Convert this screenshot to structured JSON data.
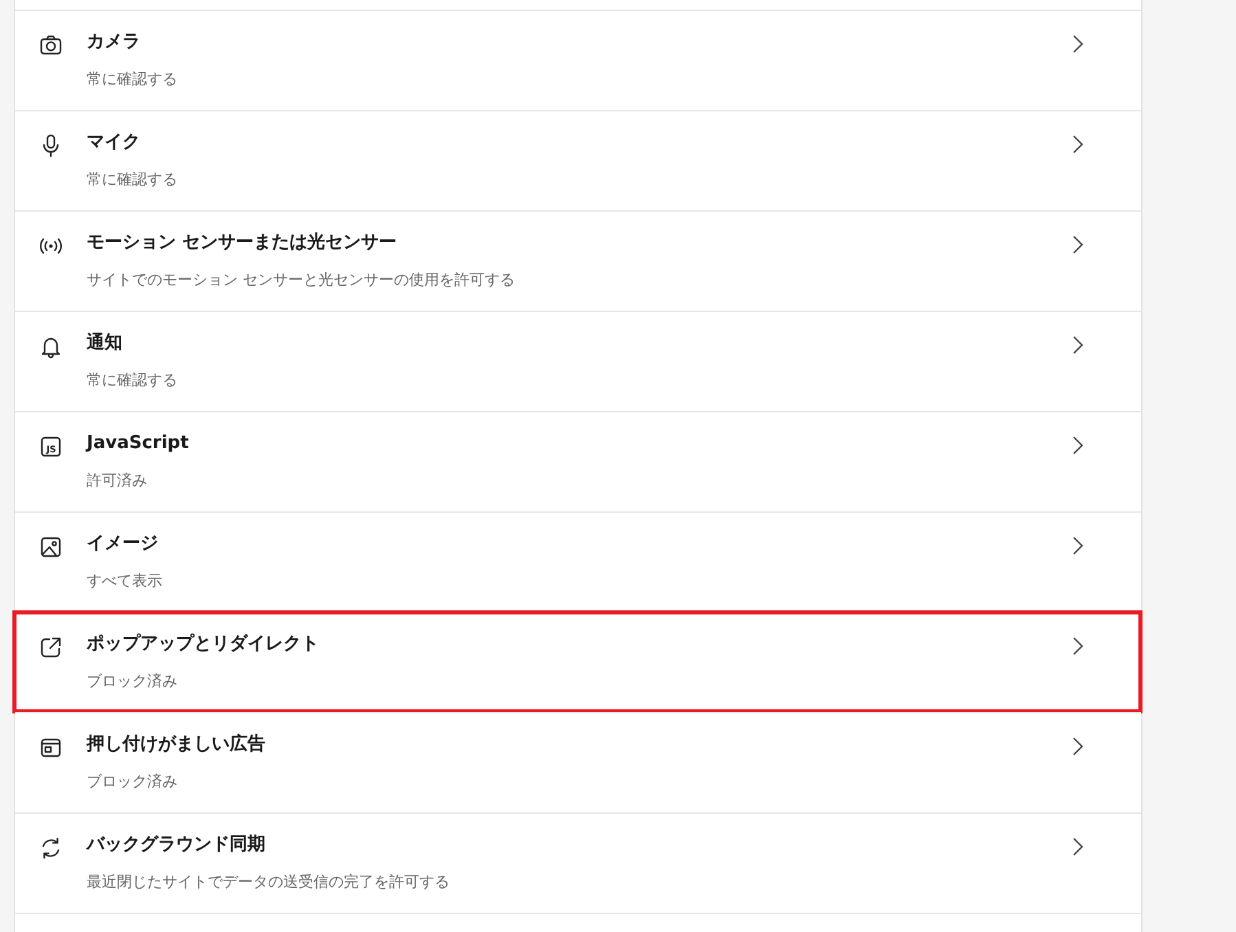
{
  "settings": [
    {
      "kind": "camera",
      "title": "カメラ",
      "subtitle": "常に確認する",
      "highlighted": false
    },
    {
      "kind": "microphone",
      "title": "マイク",
      "subtitle": "常に確認する",
      "highlighted": false
    },
    {
      "kind": "sensor",
      "title": "モーション センサーまたは光センサー",
      "subtitle": "サイトでのモーション センサーと光センサーの使用を許可する",
      "highlighted": false
    },
    {
      "kind": "bell",
      "title": "通知",
      "subtitle": "常に確認する",
      "highlighted": false
    },
    {
      "kind": "script",
      "icon_label": "JS",
      "title": "JavaScript",
      "subtitle": "許可済み",
      "highlighted": false
    },
    {
      "kind": "image",
      "title": "イメージ",
      "subtitle": "すべて表示",
      "highlighted": false
    },
    {
      "kind": "external",
      "title": "ポップアップとリダイレクト",
      "subtitle": "ブロック済み",
      "highlighted": true
    },
    {
      "kind": "ad",
      "title": "押し付けがましい広告",
      "subtitle": "ブロック済み",
      "highlighted": false
    },
    {
      "kind": "sync",
      "title": "バックグラウンド同期",
      "subtitle": "最近閉じたサイトでデータの送受信の完了を許可する",
      "highlighted": false
    }
  ]
}
